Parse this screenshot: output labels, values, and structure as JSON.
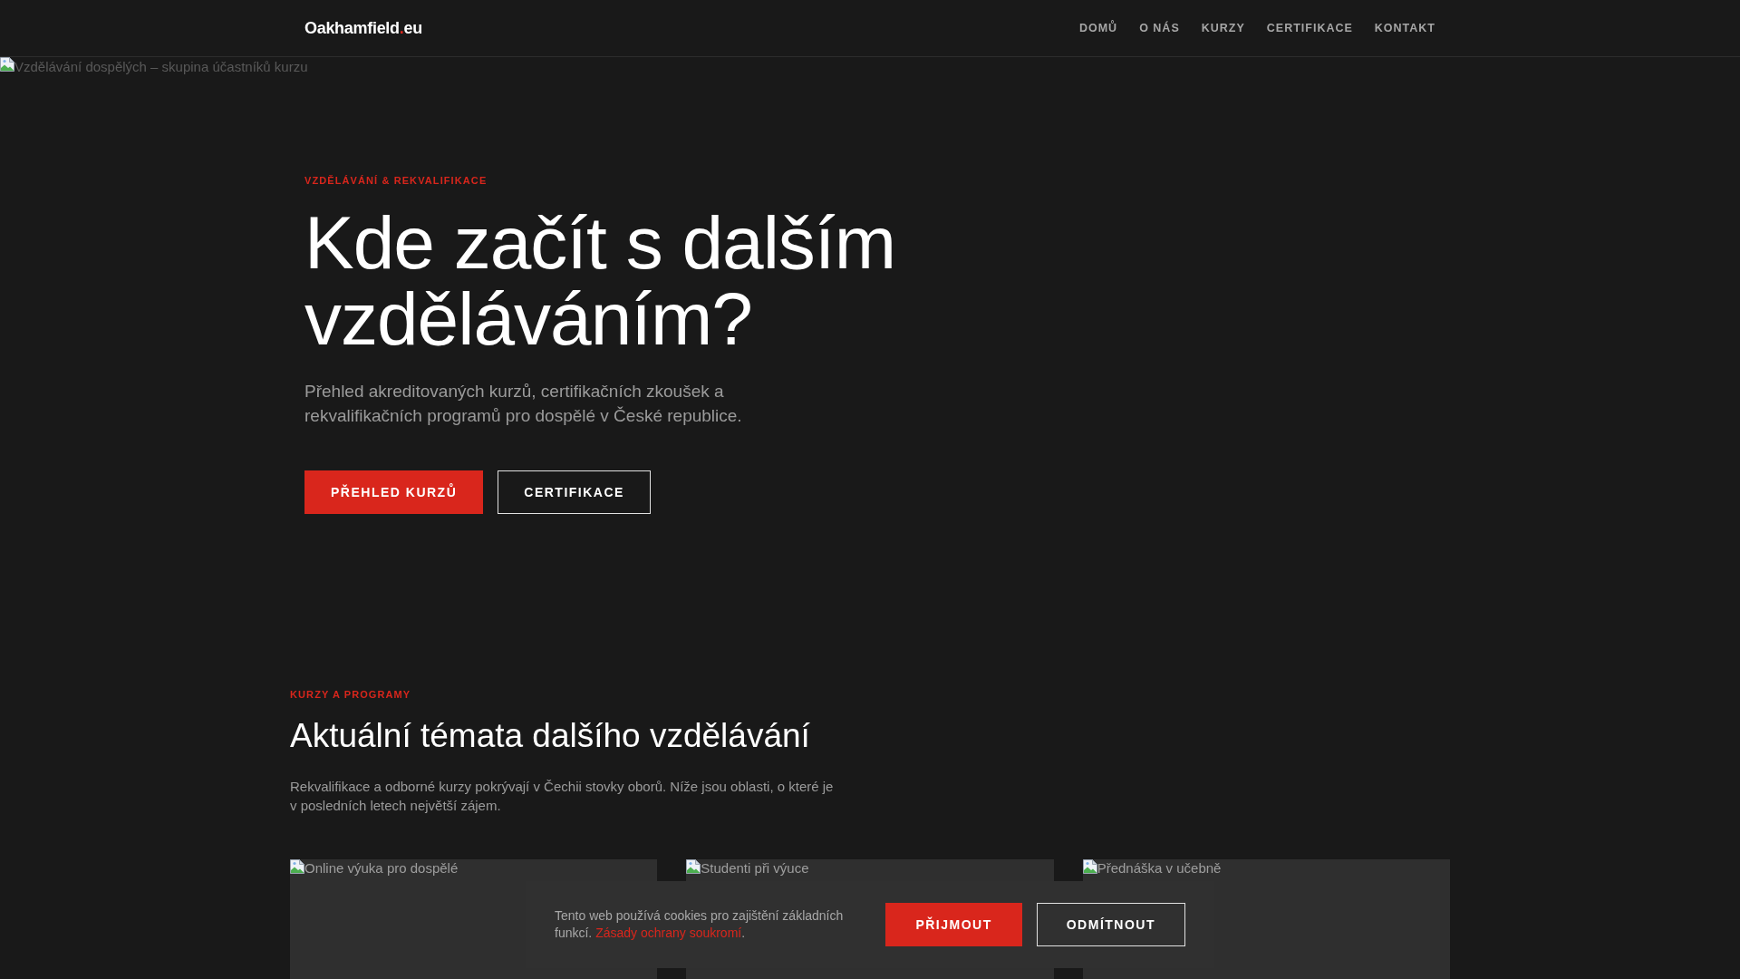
{
  "header": {
    "logo": [
      {
        "text": "Oakhamfield",
        "accent": false
      },
      {
        "text": ".",
        "accent": true
      },
      {
        "text": "eu",
        "accent": false
      }
    ],
    "nav": [
      {
        "label": "DOMŮ"
      },
      {
        "label": "O NÁS"
      },
      {
        "label": "KURZY"
      },
      {
        "label": "CERTIFIKACE"
      },
      {
        "label": "KONTAKT"
      }
    ]
  },
  "hero": {
    "image_alt": "Vzdělávání dospělých – skupina účastníků kurzu",
    "eyebrow": "VZDĚLÁVÁNÍ & REKVALIFIKACE",
    "title": "Kde začít s dalším vzděláváním?",
    "lead": "Přehled akreditovaných kurzů, certifikačních zkoušek a rekvalifikačních programů pro dospělé v České republice.",
    "buttons": [
      {
        "label": "PŘEHLED KURZŮ",
        "kind": "primary"
      },
      {
        "label": "CERTIFIKACE",
        "kind": "outline"
      }
    ]
  },
  "courses": {
    "eyebrow": "KURZY A PROGRAMY",
    "title": "Aktuální témata dalšího vzdělávání",
    "intro": "Rekvalifikace a odborné kurzy pokrývají v Čechii stovky oborů. Níže jsou oblasti, o které je v posledních letech největší zájem.",
    "cards": [
      {
        "image_alt": "Online výuka pro dospělé"
      },
      {
        "image_alt": "Studenti při výuce"
      },
      {
        "image_alt": "Přednáška v učebně"
      }
    ]
  },
  "cookie_banner": {
    "text": "Tento web používá cookies pro zajištění základních funkcí.",
    "link": "Zásady ochrany soukromí",
    "link_suffix": ".",
    "buttons": [
      {
        "label": "PŘIJMOUT",
        "kind": "primary"
      },
      {
        "label": "ODMÍTNOUT",
        "kind": "outline"
      }
    ]
  }
}
